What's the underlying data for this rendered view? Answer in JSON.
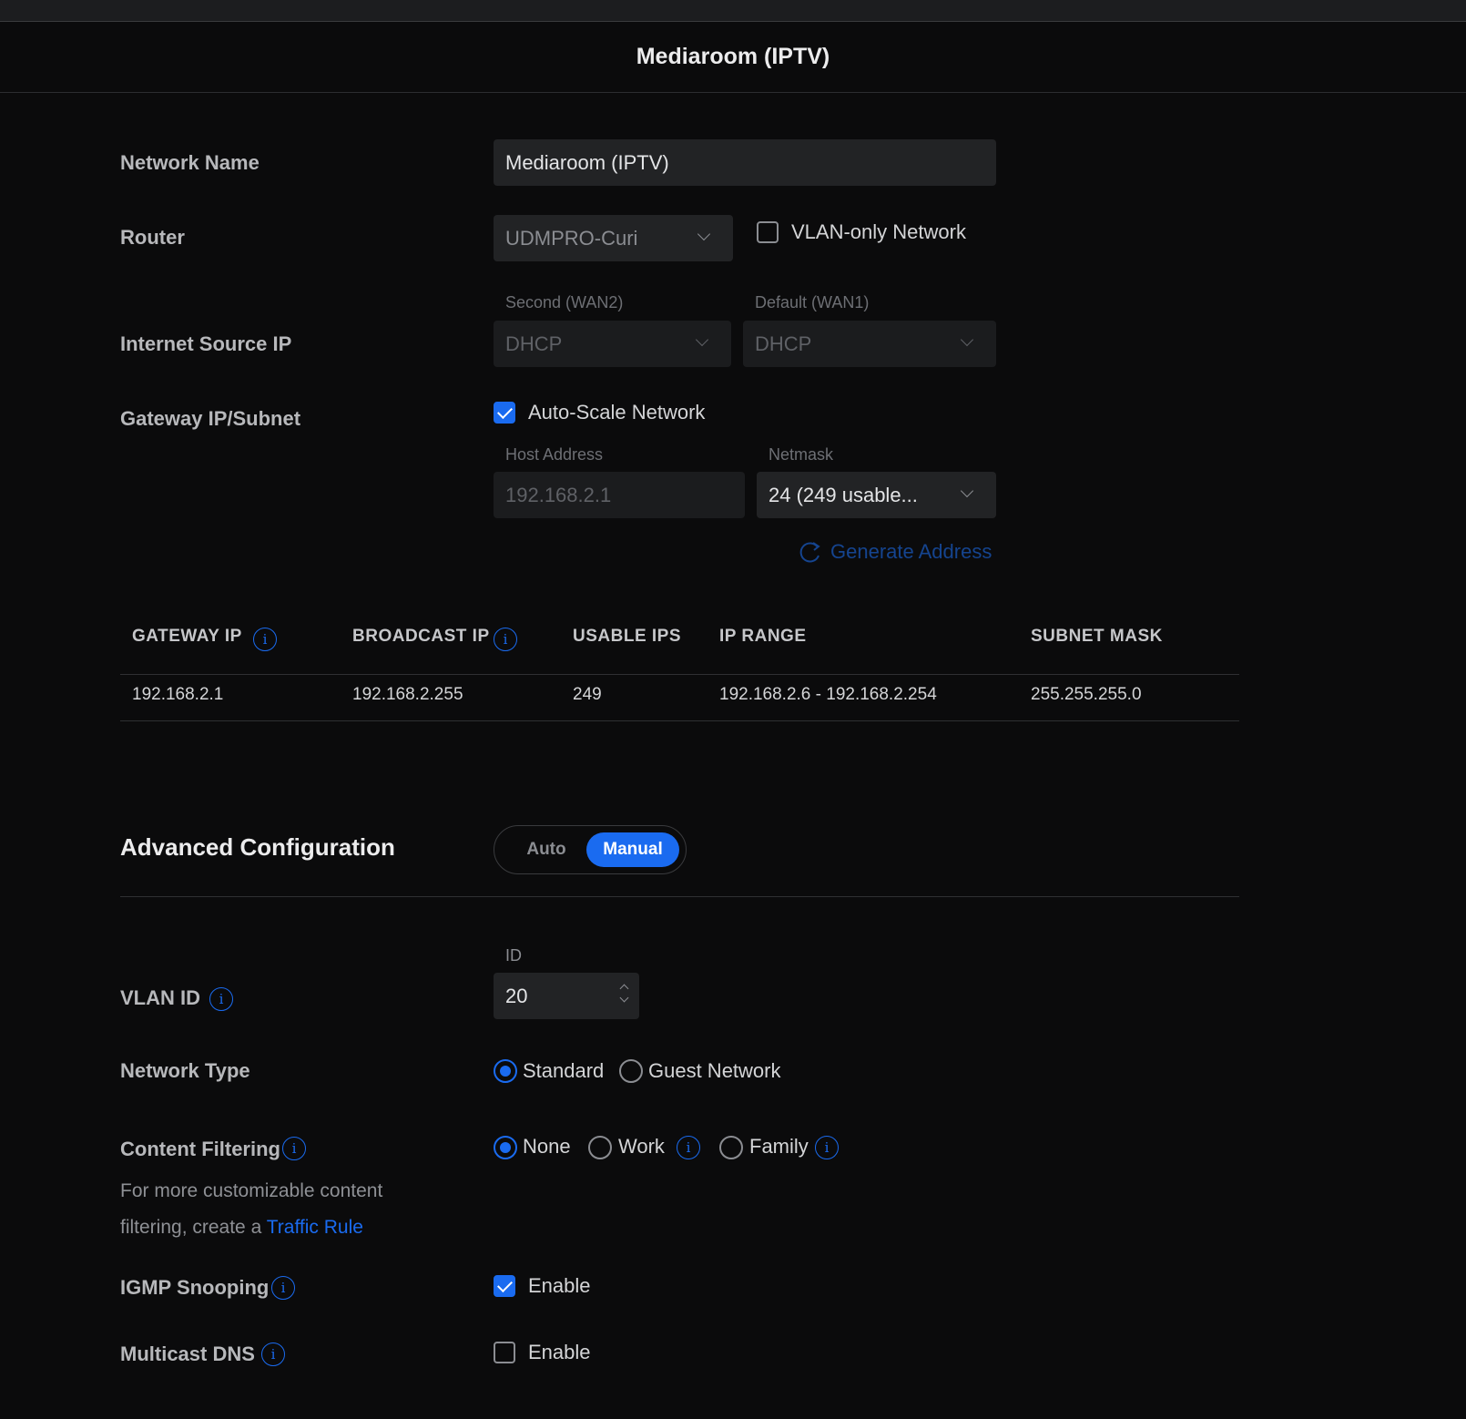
{
  "header": {
    "title": "Mediaroom (IPTV)"
  },
  "network_name": {
    "label": "Network Name",
    "value": "Mediaroom (IPTV)"
  },
  "router": {
    "label": "Router",
    "value": "UDMPRO-Curi",
    "vlan_only_label": "VLAN-only Network",
    "vlan_only_checked": false
  },
  "internet_source": {
    "label": "Internet Source IP",
    "wan2_label": "Second (WAN2)",
    "wan2_value": "DHCP",
    "wan1_label": "Default (WAN1)",
    "wan1_value": "DHCP"
  },
  "gateway": {
    "label": "Gateway IP/Subnet",
    "auto_scale_label": "Auto-Scale Network",
    "auto_scale_checked": true,
    "host_label": "Host Address",
    "host_value": "192.168.2.1",
    "netmask_label": "Netmask",
    "netmask_value": "24 (249 usable...",
    "generate_label": "Generate Address"
  },
  "ip_table": {
    "headers": {
      "gateway_ip": "GATEWAY IP",
      "broadcast_ip": "BROADCAST IP",
      "usable_ips": "USABLE IPS",
      "ip_range": "IP RANGE",
      "subnet_mask": "SUBNET MASK"
    },
    "row": {
      "gateway_ip": "192.168.2.1",
      "broadcast_ip": "192.168.2.255",
      "usable_ips": "249",
      "ip_range": "192.168.2.6 - 192.168.2.254",
      "subnet_mask": "255.255.255.0"
    }
  },
  "advanced": {
    "label": "Advanced Configuration",
    "auto_label": "Auto",
    "manual_label": "Manual",
    "selected": "Manual"
  },
  "vlan": {
    "label": "VLAN ID",
    "id_label": "ID",
    "value": "20"
  },
  "network_type": {
    "label": "Network Type",
    "options": [
      "Standard",
      "Guest Network"
    ],
    "selected": "Standard"
  },
  "content_filtering": {
    "label": "Content Filtering",
    "options": [
      "None",
      "Work",
      "Family"
    ],
    "selected": "None",
    "help_text": "For more customizable content filtering, create a",
    "help_link": "Traffic Rule"
  },
  "igmp": {
    "label": "IGMP Snooping",
    "enable_label": "Enable",
    "checked": true
  },
  "mdns": {
    "label": "Multicast DNS",
    "enable_label": "Enable",
    "checked": false
  },
  "icons": {
    "info": "i"
  },
  "colors": {
    "accent": "#1a6bf0",
    "background": "#0b0b0c"
  }
}
